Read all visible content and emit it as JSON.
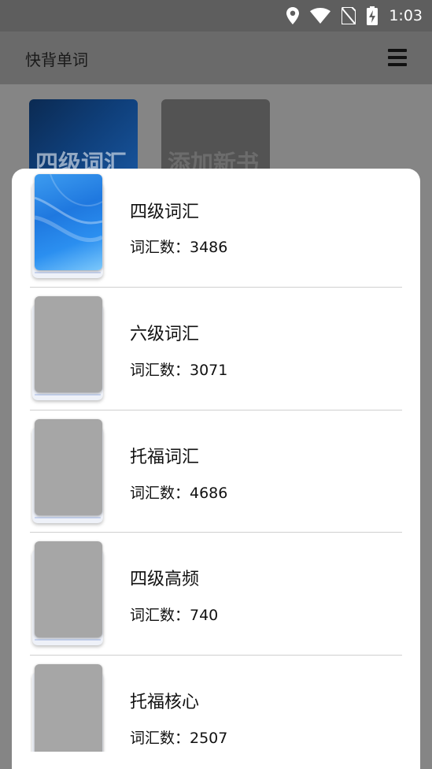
{
  "status_bar": {
    "time": "1:03",
    "icons": [
      "location-icon",
      "wifi-icon",
      "no-sim-icon",
      "battery-charging-icon"
    ]
  },
  "app_bar": {
    "title": "快背单词",
    "menu_icon": "hamburger-menu-icon"
  },
  "background": {
    "books": [
      {
        "label": "四级词汇"
      },
      {
        "label": "添加新书"
      }
    ]
  },
  "dialog": {
    "books": [
      {
        "name": "四级词汇",
        "count": "词汇数：3486",
        "cover": "blue"
      },
      {
        "name": "六级词汇",
        "count": "词汇数：3071",
        "cover": "gray"
      },
      {
        "name": "托福词汇",
        "count": "词汇数：4686",
        "cover": "gray"
      },
      {
        "name": "四级高频",
        "count": "词汇数：740",
        "cover": "gray"
      },
      {
        "name": "托福核心",
        "count": "词汇数：2507",
        "cover": "gray"
      }
    ]
  },
  "colors": {
    "status_bar": "#5e5e5e",
    "app_bar": "#6a6a6a",
    "scrim": "#858585",
    "dialog_bg": "#ffffff",
    "cover_gray": "#a6a6a6",
    "cover_blue": "#1f78df"
  }
}
